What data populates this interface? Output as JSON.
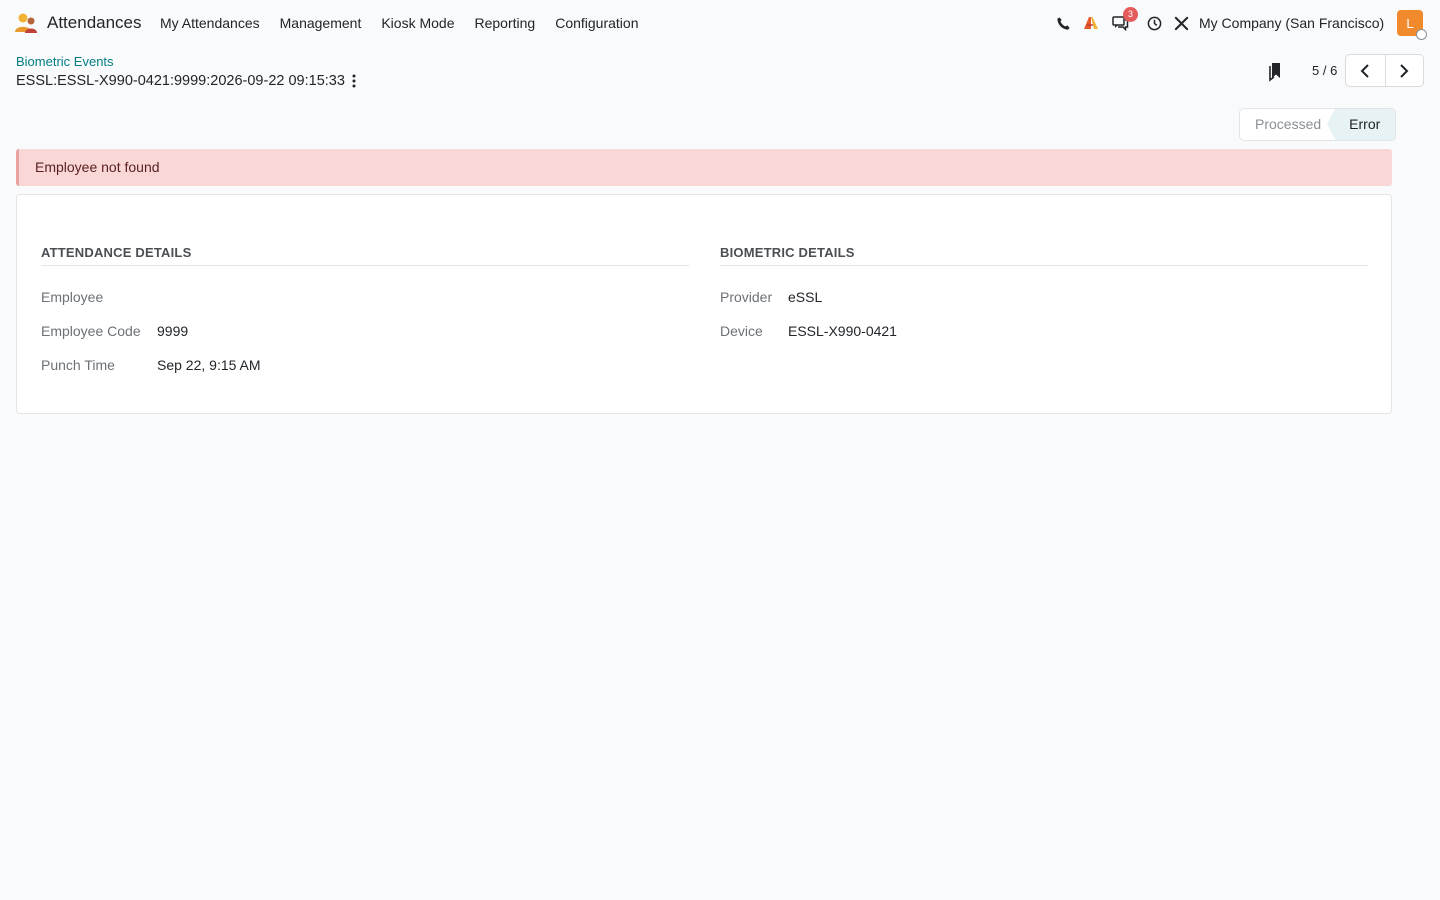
{
  "navbar": {
    "app_name": "Attendances",
    "menu": [
      "My Attendances",
      "Management",
      "Kiosk Mode",
      "Reporting",
      "Configuration"
    ],
    "notification_count": "3",
    "company": "My Company (San Francisco)",
    "avatar_initial": "L",
    "icons": [
      "phone-icon",
      "activity-icon",
      "messages-icon",
      "clock-icon",
      "tools-icon"
    ]
  },
  "control_panel": {
    "breadcrumb": "Biometric Events",
    "record_title": "ESSL:ESSL-X990-0421:9999:2026-09-22 09:15:33",
    "pager": "5 / 6"
  },
  "statusbar": {
    "steps": [
      "Processed",
      "Error"
    ],
    "active": "Error"
  },
  "alert": {
    "message": "Employee not found"
  },
  "form": {
    "attendance": {
      "title": "ATTENDANCE DETAILS",
      "employee_label": "Employee",
      "employee_value": "",
      "employee_code_label": "Employee Code",
      "employee_code_value": "9999",
      "punch_time_label": "Punch Time",
      "punch_time_value": "Sep 22, 9:15 AM"
    },
    "biometric": {
      "title": "BIOMETRIC DETAILS",
      "provider_label": "Provider",
      "provider_value": "eSSL",
      "device_label": "Device",
      "device_value": "ESSL-X990-0421"
    }
  },
  "colors": {
    "accent": "#017e84",
    "alert_bg": "#f9d7d7",
    "avatar": "#f08a2c",
    "badge": "#e35b5b"
  }
}
